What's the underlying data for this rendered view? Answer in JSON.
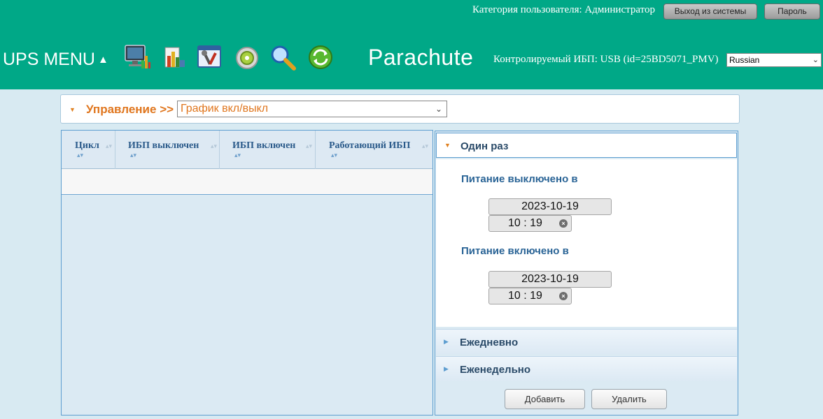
{
  "header": {
    "user_category": "Категория пользователя: Администратор",
    "logout_label": "Выход из системы",
    "password_label": "Пароль",
    "menu_label": "UPS MENU",
    "menu_arrow": "▲",
    "brand": "Parachute",
    "ups_label": "Контролируемый ИБП: USB (id=25BD5071_PMV)",
    "language": "Russian",
    "tool_icons": [
      "monitor-icon",
      "reports-icon",
      "settings-tools-icon",
      "control-dial-icon",
      "search-icon",
      "refresh-icon"
    ]
  },
  "control": {
    "label": "Управление >>",
    "selected": "График вкл/выкл"
  },
  "table": {
    "columns": [
      "Цикл",
      "ИБП выключен",
      "ИБП включен",
      "Работающий ИБП"
    ],
    "rows": []
  },
  "schedule": {
    "once_title": "Один раз",
    "power_off_label": "Питание выключено в",
    "power_off_date": "2023-10-19",
    "power_off_time": "10 : 19",
    "power_on_label": "Питание включено в",
    "power_on_date": "2023-10-19",
    "power_on_time": "10 : 19",
    "daily_title": "Ежедневно",
    "weekly_title": "Еженедельно",
    "add_label": "Добавить",
    "delete_label": "Удалить"
  },
  "colors": {
    "header_bg": "#00a887",
    "accent_orange": "#e0761e",
    "panel_bg": "#dbeaf3"
  }
}
